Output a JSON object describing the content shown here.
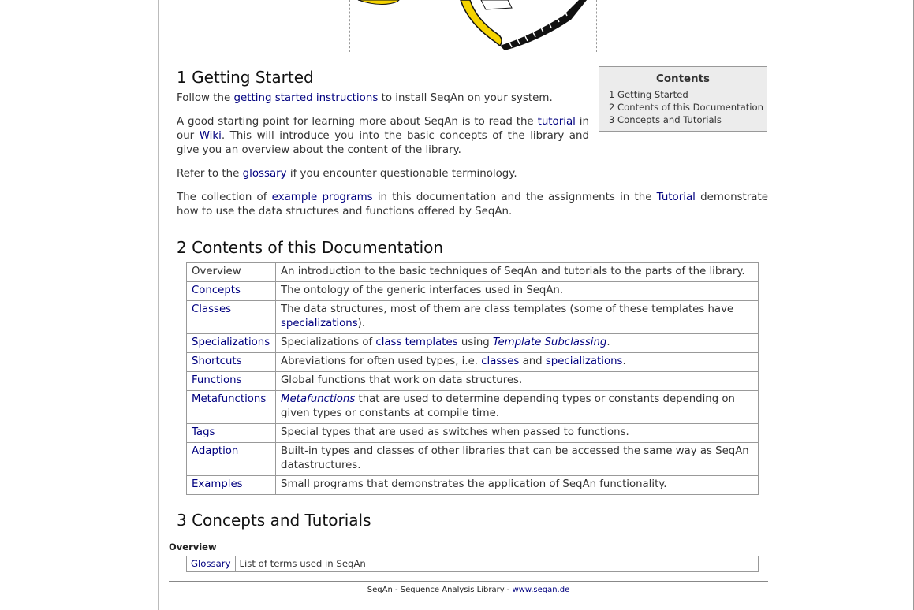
{
  "sec1": {
    "heading": "1 Getting Started",
    "p1": {
      "pre": "Follow the ",
      "link": "getting started instructions",
      "post": " to install SeqAn on your system."
    },
    "p2": {
      "pre": "A good starting point for learning more about SeqAn is to read the ",
      "link1": "tutorial",
      "mid": " in our ",
      "link2": "Wiki",
      "post": ". This will introduce you into the basic concepts of the library and give you an overview about the content of the library."
    },
    "p3": {
      "pre": "Refer to the ",
      "link": "glossary",
      "post": " if you encounter questionable terminology."
    },
    "p4": {
      "pre": "The collection of ",
      "link1": "example programs",
      "mid": " in this documentation and the assignments in the ",
      "link2": "Tutorial",
      "post": " demonstrate how to use the data structures and functions offered by SeqAn."
    }
  },
  "toc": {
    "title": "Contents",
    "items": [
      "1 Getting Started",
      "2 Contents of this Documentation",
      "3 Concepts and Tutorials"
    ]
  },
  "sec2": {
    "heading": "2 Contents of this Documentation",
    "rows": [
      {
        "name": "Overview",
        "desc": "An introduction to the basic techniques of SeqAn and tutorials to the parts of the library."
      },
      {
        "name": "Concepts",
        "desc": "The ontology of the generic interfaces used in SeqAn."
      },
      {
        "name": "Classes",
        "desc_pre": "The data structures, most of them are class templates (some of these templates have ",
        "desc_link": "specializations",
        "desc_post": ")."
      },
      {
        "name": "Specializations",
        "desc_pre": "Specializations of ",
        "desc_link": "class templates",
        "desc_mid": " using ",
        "desc_em": "Template Subclassing",
        "desc_post": "."
      },
      {
        "name": "Shortcuts",
        "desc_pre": "Abreviations for often used types, i.e. ",
        "desc_link1": "classes",
        "desc_mid": " and ",
        "desc_link2": "specializations",
        "desc_post": "."
      },
      {
        "name": "Functions",
        "desc": "Global functions that work on data structures."
      },
      {
        "name": "Metafunctions",
        "desc_em": "Metafunctions",
        "desc_post": " that are used to determine depending types or constants depending on given types or constants at compile time."
      },
      {
        "name": "Tags",
        "desc": "Special types that are used as switches when passed to functions."
      },
      {
        "name": "Adaption",
        "desc": "Built-in types and classes of other libraries that can be accessed the same way as SeqAn datastructures."
      },
      {
        "name": "Examples",
        "desc": "Small programs that demonstrates the application of SeqAn functionality."
      }
    ]
  },
  "sec3": {
    "heading": "3 Concepts and Tutorials",
    "overview_label": "Overview",
    "glossary_name": "Glossary",
    "glossary_desc": "List of terms used in SeqAn"
  },
  "footer": {
    "text": "SeqAn - Sequence Analysis Library - ",
    "link": "www.seqan.de"
  },
  "logo": {
    "colors": {
      "yellow": "#f5d300",
      "black": "#111111"
    }
  }
}
